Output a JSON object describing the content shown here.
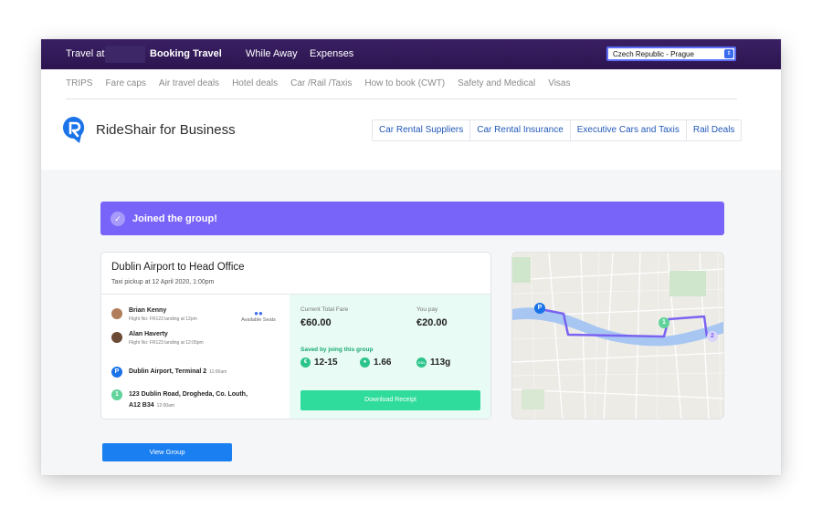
{
  "topbar": {
    "travel_at": "Travel at",
    "booking_travel": "Booking Travel",
    "while_away": "While Away",
    "expenses": "Expenses",
    "location_select": "Czech Republic - Prague"
  },
  "subnav": [
    "TRIPS",
    "Fare caps",
    "Air travel deals",
    "Hotel deals",
    "Car /Rail /Taxis",
    "How to book (CWT)",
    "Safety and Medical",
    "Visas"
  ],
  "brand": {
    "name": "RideShair for Business"
  },
  "links": [
    "Car Rental Suppliers",
    "Car Rental Insurance",
    "Executive Cars and Taxis",
    "Rail Deals"
  ],
  "banner": {
    "text": "Joined the group!"
  },
  "trip": {
    "title": "Dublin Airport to Head Office",
    "subtitle": "Taxi pickup at 12 April 2020, 1:00pm",
    "passengers": [
      {
        "name": "Brian Kenny",
        "info": "Flight No: FR123 landing at 12pm"
      },
      {
        "name": "Alan Haverty",
        "info": "Flight No: FR123 landing at 12:05pm"
      }
    ],
    "seats_label": "Available Seats",
    "pickup": {
      "marker": "P",
      "address": "Dublin Airport, Terminal 2",
      "time": "11:00am"
    },
    "dropoff": {
      "marker": "1",
      "address_line1": "123 Dublin Road, Drogheda, Co. Louth,",
      "address_line2": "A12 B34",
      "time": "12:00am"
    }
  },
  "fare": {
    "current_label": "Current Total Fare",
    "current_value": "€60.00",
    "you_pay_label": "You pay",
    "you_pay_value": "€20.00",
    "saved_label": "Saved by joing this group",
    "metrics": [
      {
        "icon": "euro-icon",
        "glyph": "€",
        "value": "12-15"
      },
      {
        "icon": "drop-icon",
        "glyph": "●",
        "value": "1.66"
      },
      {
        "icon": "co2-icon",
        "glyph": "CO₂",
        "value": "113g"
      }
    ],
    "download_label": "Download Receipt"
  },
  "map": {
    "pickup_marker": "P",
    "stop_marker": "1",
    "stop2_marker": "2"
  },
  "view_group_label": "View Group",
  "colors": {
    "topbar": "#2c1550",
    "banner": "#7864f9",
    "accent_green": "#2fdc9c",
    "primary_blue": "#1a7ff0",
    "route": "#7a63f0"
  }
}
